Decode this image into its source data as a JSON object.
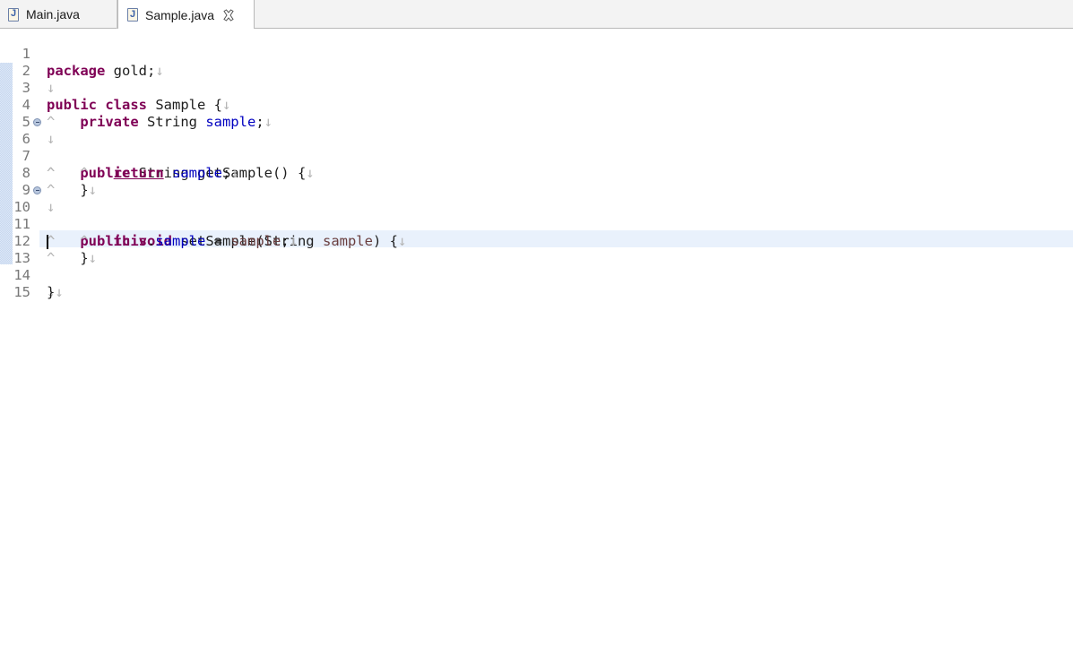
{
  "tabs": [
    {
      "label": "Main.java",
      "icon": "java-file-icon",
      "active": false
    },
    {
      "label": "Sample.java",
      "icon": "java-file-icon",
      "active": true,
      "closable": true
    }
  ],
  "editor": {
    "file": "Sample.java",
    "current_line": 13,
    "lines": [
      {
        "number": "1",
        "code": "package gold;"
      },
      {
        "number": "2",
        "code": ""
      },
      {
        "number": "3",
        "code": "public class Sample {"
      },
      {
        "number": "4",
        "code": "\tprivate String sample;"
      },
      {
        "number": "5",
        "code": ""
      },
      {
        "number": "6",
        "code": "\tpublic String getSample() {",
        "foldable": true
      },
      {
        "number": "7",
        "code": "\t\treturn sample;"
      },
      {
        "number": "8",
        "code": "\t}"
      },
      {
        "number": "9",
        "code": ""
      },
      {
        "number": "10",
        "code": "\tpublic void setSample(String sample) {",
        "foldable": true
      },
      {
        "number": "11",
        "code": "\t\tthis.sample = sample;"
      },
      {
        "number": "12",
        "code": "\t}"
      },
      {
        "number": "13",
        "code": ""
      },
      {
        "number": "14",
        "code": "}"
      },
      {
        "number": "15",
        "code": ""
      }
    ]
  },
  "colors": {
    "keyword": "#7f0055",
    "field": "#0000c0",
    "parameter": "#6a3e3e",
    "whitespace_marker": "#b4b4b4",
    "current_line": "#e9f1fc",
    "line_number": "#787878"
  }
}
